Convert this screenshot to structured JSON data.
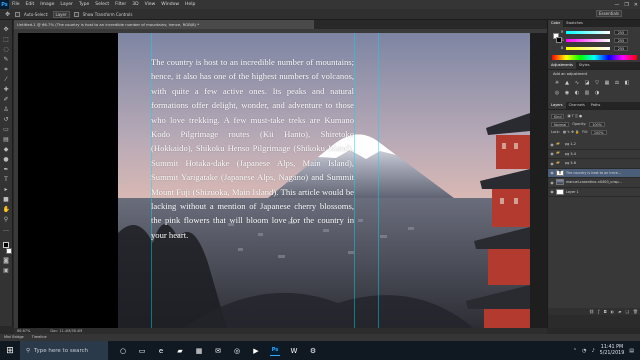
{
  "menubar": {
    "logo": "Ps",
    "items": [
      "File",
      "Edit",
      "Image",
      "Layer",
      "Type",
      "Select",
      "Filter",
      "3D",
      "View",
      "Window",
      "Help"
    ],
    "win_controls": [
      "—",
      "❐",
      "✕"
    ]
  },
  "optionsbar": {
    "auto_select_label": "Auto-Select:",
    "auto_select_value": "Layer",
    "show_transform_label": "Show Transform Controls",
    "workspace": "Essentials"
  },
  "document": {
    "tab_title": "Untitled-1 @ 66.7% (The country is host to an incredible number of mountains; hence, RGB/8) *",
    "zoom": "66.67%",
    "doc_size": "Doc: 11.4M/38.4M",
    "body_text": "The country is host to an incredible number of mountains; hence, it also has one of the highest numbers of volcanos, with quite a few active ones. Its peaks and natural formations offer delight, wonder, and adventure to those who love trekking. A few must-take treks are Kumano Kodo Pilgrimage routes (Kii Hanto), Shiretoko (Hokkaido), Shikoku Henso Pilgrimage (Shikoku Island), Summit Hotaka-dake (Japanese Alps, Main Island), Summit Yarigatake (Japanese Alps, Nagano) and Summit Mount Fuji (Shizuoka, Main Island). This article would be lacking without a mention of Japanese cherry blossoms, the pink flowers that will bloom love for the country in your heart."
  },
  "panels": {
    "color_tabs": [
      "Color",
      "Swatches"
    ],
    "sliders": [
      {
        "label": "R",
        "value": "255"
      },
      {
        "label": "G",
        "value": "255"
      },
      {
        "label": "B",
        "value": "255"
      }
    ],
    "adjust_tabs": [
      "Adjustments",
      "Styles"
    ],
    "adjust_title": "Add an adjustment",
    "layers_tabs": [
      "Layers",
      "Channels",
      "Paths"
    ],
    "kind_label": "Kind",
    "blend_mode": "Normal",
    "opacity_label": "Opacity:",
    "opacity_value": "100%",
    "lock_label": "Lock:",
    "fill_label": "Fill:",
    "fill_value": "100%",
    "layers": [
      {
        "name": "pg 1-2",
        "type": "folder",
        "selected": false
      },
      {
        "name": "pg 3-4",
        "type": "folder",
        "selected": false
      },
      {
        "name": "pg 5-6",
        "type": "folder",
        "selected": false
      },
      {
        "name": "The country is host to an incre...",
        "type": "text",
        "selected": true
      },
      {
        "name": "manuel-cosentino-nX400_unsp...",
        "type": "photo",
        "selected": false
      },
      {
        "name": "Layer 1",
        "type": "plain",
        "selected": false
      }
    ]
  },
  "minibridge": {
    "tabs": [
      "Mini Bridge",
      "Timeline"
    ]
  },
  "taskbar": {
    "search_placeholder": "Type here to search",
    "time": "11:41 PM",
    "date": "5/21/2019"
  }
}
